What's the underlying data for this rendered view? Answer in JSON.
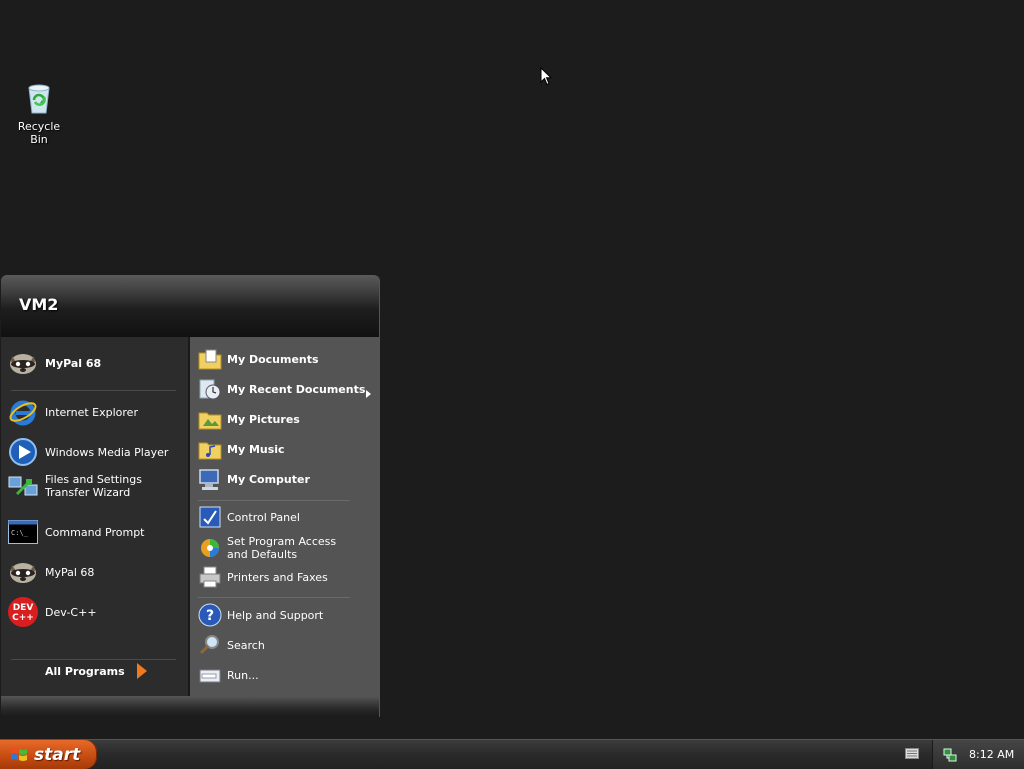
{
  "desktop": {
    "icons": [
      {
        "label": "Recycle Bin",
        "icon": "recycle-bin-icon"
      }
    ]
  },
  "start_menu": {
    "user": "VM2",
    "pinned": [
      {
        "label": "MyPal 68",
        "icon": "mypal-icon"
      }
    ],
    "recent": [
      {
        "label": "Internet Explorer",
        "icon": "internet-explorer-icon"
      },
      {
        "label": "Windows Media Player",
        "icon": "media-player-icon"
      },
      {
        "label": "Files and Settings Transfer Wizard",
        "icon": "transfer-wizard-icon"
      },
      {
        "label": "Command Prompt",
        "icon": "command-prompt-icon"
      },
      {
        "label": "MyPal 68",
        "icon": "mypal-icon"
      },
      {
        "label": "Dev-C++",
        "icon": "devcpp-icon"
      }
    ],
    "all_programs": "All Programs",
    "places": [
      {
        "label": "My Documents",
        "icon": "documents-folder-icon"
      },
      {
        "label": "My Recent Documents",
        "icon": "recent-documents-icon"
      },
      {
        "label": "My Pictures",
        "icon": "pictures-folder-icon"
      },
      {
        "label": "My Music",
        "icon": "music-folder-icon"
      },
      {
        "label": "My Computer",
        "icon": "computer-icon"
      }
    ],
    "system": [
      {
        "label": "Control Panel",
        "icon": "control-panel-icon"
      },
      {
        "label": "Set Program Access and Defaults",
        "icon": "program-defaults-icon"
      },
      {
        "label": "Printers and Faxes",
        "icon": "printer-icon"
      }
    ],
    "help": [
      {
        "label": "Help and Support",
        "icon": "help-icon"
      },
      {
        "label": "Search",
        "icon": "search-icon"
      },
      {
        "label": "Run...",
        "icon": "run-icon"
      }
    ]
  },
  "taskbar": {
    "start_label": "start",
    "clock": "8:12 AM"
  },
  "colors": {
    "desktop": "#1c1c1c",
    "start_button": "#c44a10",
    "menu_left": "#2c2c2c",
    "menu_right": "#545454"
  }
}
